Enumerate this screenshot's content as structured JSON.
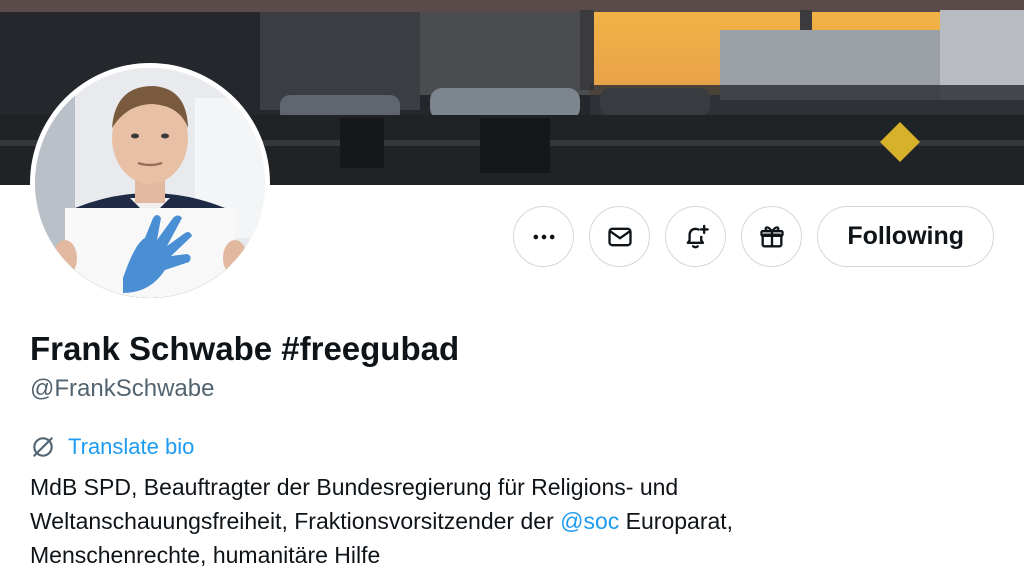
{
  "profile": {
    "display_name": "Frank Schwabe #freegubad",
    "handle": "@FrankSchwabe",
    "translate_label": "Translate bio",
    "bio": {
      "line1": "MdB SPD, Beauftragter der Bundesregierung für Religions- und",
      "line2_before": "Weltanschauungsfreiheit, Fraktionsvorsitzender der ",
      "mention": "@soc",
      "line2_after": " Europarat,",
      "line3": "Menschenrechte, humanitäre Hilfe"
    }
  },
  "actions": {
    "items": [
      {
        "name": "more",
        "icon": "more-horizontal-icon"
      },
      {
        "name": "message",
        "icon": "envelope-icon"
      },
      {
        "name": "notifications",
        "icon": "bell-plus-icon"
      },
      {
        "name": "gift",
        "icon": "gift-icon"
      }
    ],
    "follow_label": "Following"
  },
  "colors": {
    "accent": "#1d9bf0",
    "text_primary": "#0f1419",
    "text_secondary": "#536471",
    "border": "#cfd9de"
  }
}
